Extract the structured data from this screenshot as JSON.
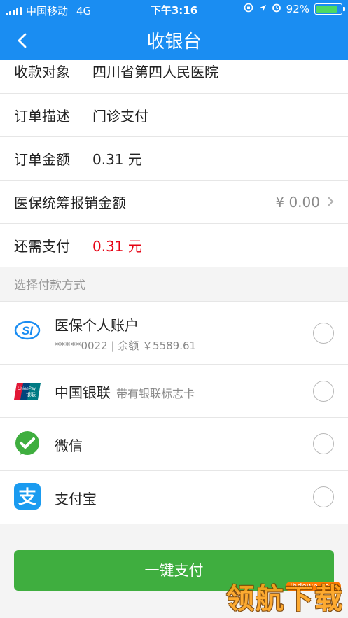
{
  "status_bar": {
    "carrier": "中国移动",
    "network": "4G",
    "time": "下午3:16",
    "battery_percent_label": "92%",
    "battery_level": 0.92
  },
  "nav": {
    "title": "收银台"
  },
  "order": {
    "payee_label": "收款对象",
    "payee_value": "四川省第四人民医院",
    "desc_label": "订单描述",
    "desc_value": "门诊支付",
    "amount_label": "订单金额",
    "amount_value": "0.31 元",
    "insurance_label": "医保统筹报销金额",
    "insurance_value": "¥ 0.00",
    "due_label": "还需支付",
    "due_value": "0.31 元"
  },
  "section_title": "选择付款方式",
  "payment_methods": [
    {
      "name": "医保个人账户",
      "detail": "*****0022 | 余额 ￥5589.61",
      "icon": "social-insurance-icon"
    },
    {
      "name": "中国银联",
      "detail": "带有银联标志卡",
      "icon": "unionpay-icon"
    },
    {
      "name": "微信",
      "icon": "wechat-icon"
    },
    {
      "name": "支付宝",
      "icon": "alipay-icon"
    }
  ],
  "pay_button": "一键支付",
  "watermark": {
    "site": "lhdown.com",
    "brand": "领航下载"
  },
  "colors": {
    "header": "#1a8df2",
    "due_amount": "#e60012",
    "pay_button": "#3fae3f"
  }
}
